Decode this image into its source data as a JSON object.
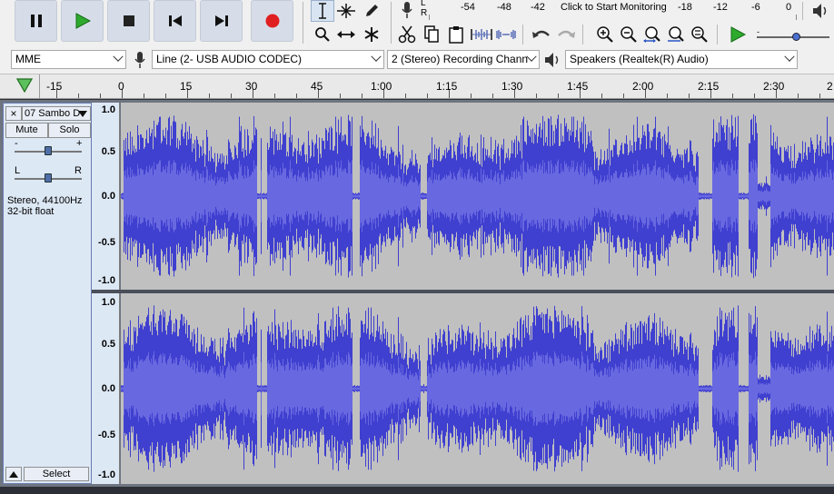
{
  "meter": {
    "lr_left": "L",
    "lr_right": "R",
    "ticks": [
      "-54",
      "-48",
      "-42",
      "-18",
      "-12",
      "-6",
      "0"
    ],
    "monitor_text": "Click to Start Monitoring"
  },
  "devices": {
    "host": "MME",
    "input": "Line (2- USB AUDIO  CODEC)",
    "channels": "2 (Stereo) Recording Chann",
    "output": "Speakers (Realtek(R) Audio)"
  },
  "timeline": {
    "labels": [
      "-15",
      "0",
      "15",
      "30",
      "45",
      "1:00",
      "1:15",
      "1:30",
      "1:45",
      "2:00",
      "2:15",
      "2:30",
      "2"
    ]
  },
  "track": {
    "close_label": "×",
    "name": "07 Sambo D",
    "mute_label": "Mute",
    "solo_label": "Solo",
    "gain_minus": "-",
    "gain_plus": "+",
    "pan_left": "L",
    "pan_right": "R",
    "format_line1": "Stereo, 44100Hz",
    "format_line2": "32-bit float",
    "select_label": "Select",
    "gain_level": 0.5,
    "pan_level": 0.5
  },
  "amplitude_labels": [
    "1.0",
    "0.5",
    "0.0",
    "-0.5",
    "-1.0"
  ],
  "colors": {
    "waveform": "#3f3fd0",
    "waveform_rms": "#6868e0",
    "waveform_bg": "#c0c0c0",
    "play_green": "#2eaa2e",
    "record_red": "#e02020"
  },
  "icons": {
    "pause": "pause-icon",
    "play": "play-icon",
    "stop": "stop-icon",
    "skip_start": "skip-to-start-icon",
    "skip_end": "skip-to-end-icon",
    "record": "record-icon"
  }
}
